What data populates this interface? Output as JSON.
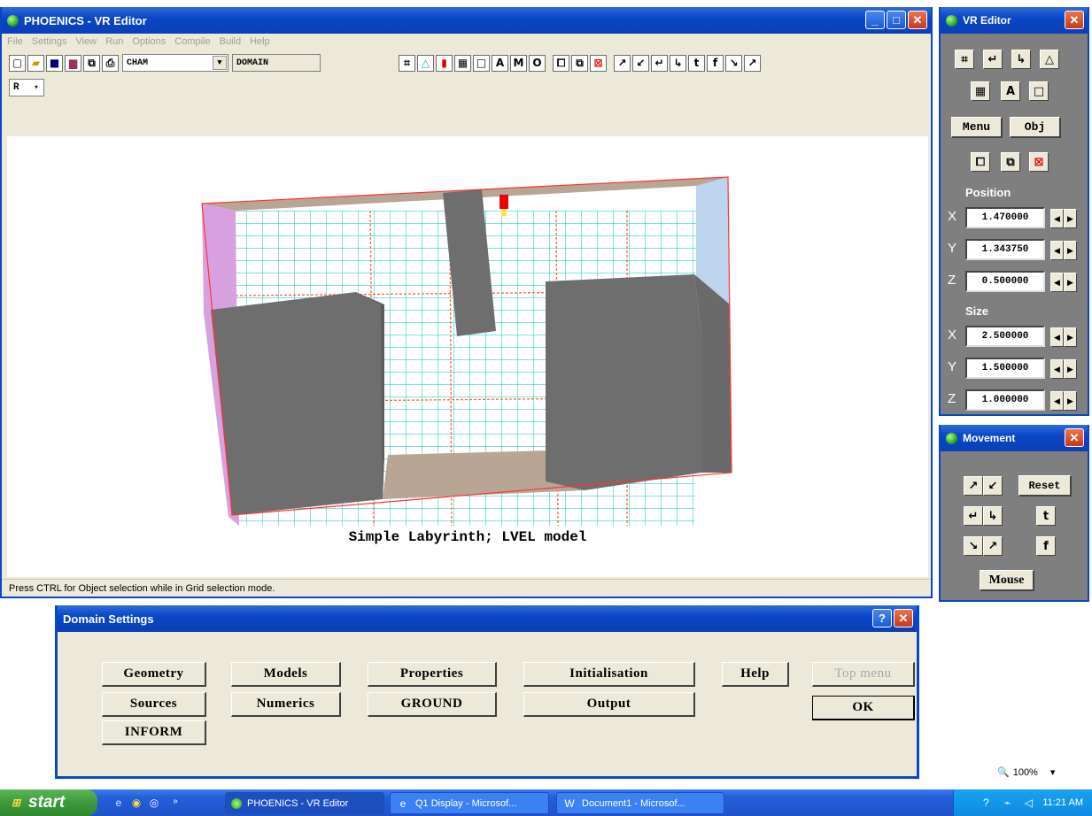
{
  "main_window": {
    "title": "PHOENICS - VR Editor",
    "menu": [
      "File",
      "Settings",
      "View",
      "Run",
      "Options",
      "Compile",
      "Build",
      "Help"
    ],
    "toolbar": {
      "object_select": "CHAM",
      "object_field": "DOMAIN",
      "small_select": "R"
    },
    "caption": "Simple Labyrinth; LVEL model",
    "status": "Press CTRL for Object selection while in Grid selection mode."
  },
  "vr_editor": {
    "title": "VR Editor",
    "menu_button": "Menu",
    "obj_button": "Obj",
    "position_label": "Position",
    "size_label": "Size",
    "axes": [
      "X",
      "Y",
      "Z"
    ],
    "position": [
      "1.470000",
      "1.343750",
      "0.500000"
    ],
    "size": [
      "2.500000",
      "1.500000",
      "1.000000"
    ]
  },
  "movement": {
    "title": "Movement",
    "reset": "Reset",
    "mouse": "Mouse"
  },
  "dialog": {
    "title": "Domain Settings",
    "buttons": {
      "geometry": "Geometry",
      "models": "Models",
      "properties": "Properties",
      "initialisation": "Initialisation",
      "help": "Help",
      "top_menu": "Top menu",
      "sources": "Sources",
      "numerics": "Numerics",
      "ground": "GROUND",
      "output": "Output",
      "ok": "OK",
      "inform": "INFORM"
    }
  },
  "zoom": "100%",
  "taskbar": {
    "start": "start",
    "tasks": [
      "PHOENICS - VR Editor",
      "Q1 Display - Microsof...",
      "Document1 - Microsof..."
    ],
    "clock": "11:21 AM"
  },
  "colors": {
    "titlebar_blue": "#0a46c8",
    "grid_cyan": "#33cccc",
    "grid_orange": "#ff6633",
    "block_gray": "#6e6e6e",
    "wall_pink": "#d7a1e0",
    "wall_blue": "#bcd4ee",
    "floor_tan": "#b8a594"
  }
}
